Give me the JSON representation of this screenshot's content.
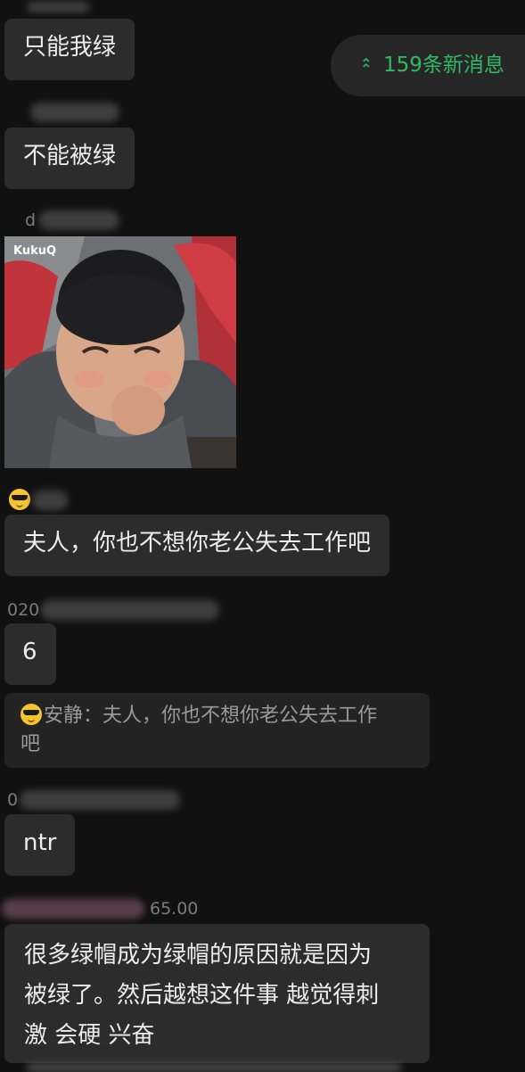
{
  "new_messages": {
    "label": "159条新消息",
    "icon": "double-chevron-up-icon",
    "color": "#2dbb63"
  },
  "messages": [
    {
      "text": "只能我绿"
    },
    {
      "sender_visible": "",
      "text": "不能被绿"
    },
    {
      "sender_visible": "d",
      "type": "image",
      "watermark": "KukuQ"
    },
    {
      "sender_visible": "",
      "text": "夫人，你也不想你老公失去工作吧"
    },
    {
      "sender_visible": "020",
      "text": "6"
    },
    {
      "quote": {
        "sender": "安静",
        "text": "安静：夫人，你也不想你老公失去工作吧"
      }
    },
    {
      "sender_visible": "0",
      "text": "ntr"
    },
    {
      "sender_visible": "65.00",
      "text": "很多绿帽成为绿帽的原因就是因为被绿了。然后越想这件事 越觉得刺激 会硬 兴奋"
    }
  ],
  "quote_line1": "安静：夫人，你也不想你老公失去工作",
  "quote_line2": "吧",
  "long_line1": "很多绿帽成为绿帽的原因就是因为",
  "long_line2": "被绿了。然后越想这件事 越觉得刺",
  "long_line3": "激 会硬 兴奋"
}
